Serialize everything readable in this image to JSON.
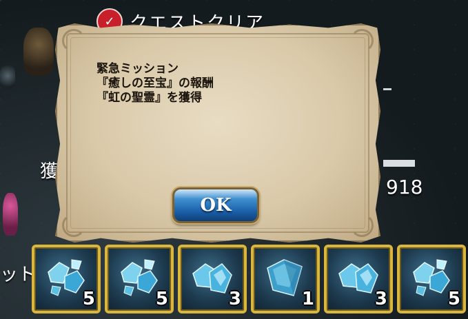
{
  "background": {
    "title": "クエストクリア",
    "left_label": "獲",
    "right_number": "918",
    "side_text": "ット"
  },
  "dialog": {
    "lines": [
      "緊急ミッション",
      "『癒しの至宝』の報酬",
      "『虹の聖霊』を獲得"
    ],
    "ok_label": "OK"
  },
  "rewards": [
    {
      "icon": "crystal-cluster-icon",
      "qty": "5"
    },
    {
      "icon": "crystal-cluster-icon",
      "qty": "5"
    },
    {
      "icon": "crystal-pair-icon",
      "qty": "3"
    },
    {
      "icon": "crystal-large-icon",
      "qty": "1"
    },
    {
      "icon": "crystal-pair-icon",
      "qty": "3"
    },
    {
      "icon": "crystal-cluster-icon",
      "qty": "5"
    }
  ],
  "colors": {
    "slot_border": "#d9b640",
    "ok_button": "#1a5fa8",
    "parchment": "#d9c9a9",
    "badge": "#c8202a"
  }
}
